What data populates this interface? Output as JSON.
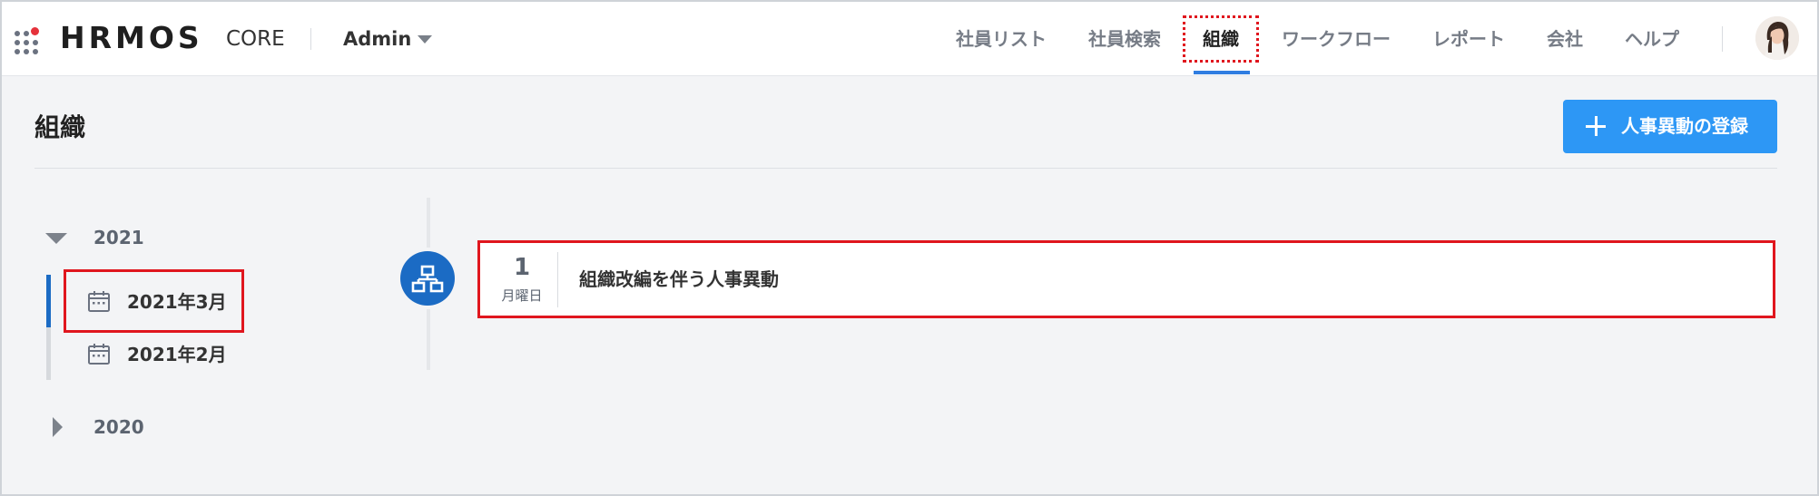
{
  "header": {
    "logo": "HRMOS",
    "logo_sub": "CORE",
    "workspace": "Admin",
    "nav": [
      {
        "label": "社員リスト",
        "active": false
      },
      {
        "label": "社員検索",
        "active": false
      },
      {
        "label": "組織",
        "active": true
      },
      {
        "label": "ワークフロー",
        "active": false
      },
      {
        "label": "レポート",
        "active": false
      },
      {
        "label": "会社",
        "active": false
      },
      {
        "label": "ヘルプ",
        "active": false
      }
    ]
  },
  "page": {
    "title": "組織",
    "add_button_label": "人事異動の登録"
  },
  "tree": {
    "years": [
      {
        "label": "2021",
        "expanded": true,
        "months": [
          {
            "label": "2021年3月",
            "selected": true
          },
          {
            "label": "2021年2月",
            "selected": false
          }
        ]
      },
      {
        "label": "2020",
        "expanded": false,
        "months": []
      }
    ]
  },
  "events": [
    {
      "day": "1",
      "weekday": "月曜日",
      "title": "組織改編を伴う人事異動"
    }
  ],
  "colors": {
    "accent": "#2d97f5",
    "nav_underline": "#2f7de1",
    "org_icon_bg": "#1b6bc4",
    "highlight": "#e0161e"
  }
}
